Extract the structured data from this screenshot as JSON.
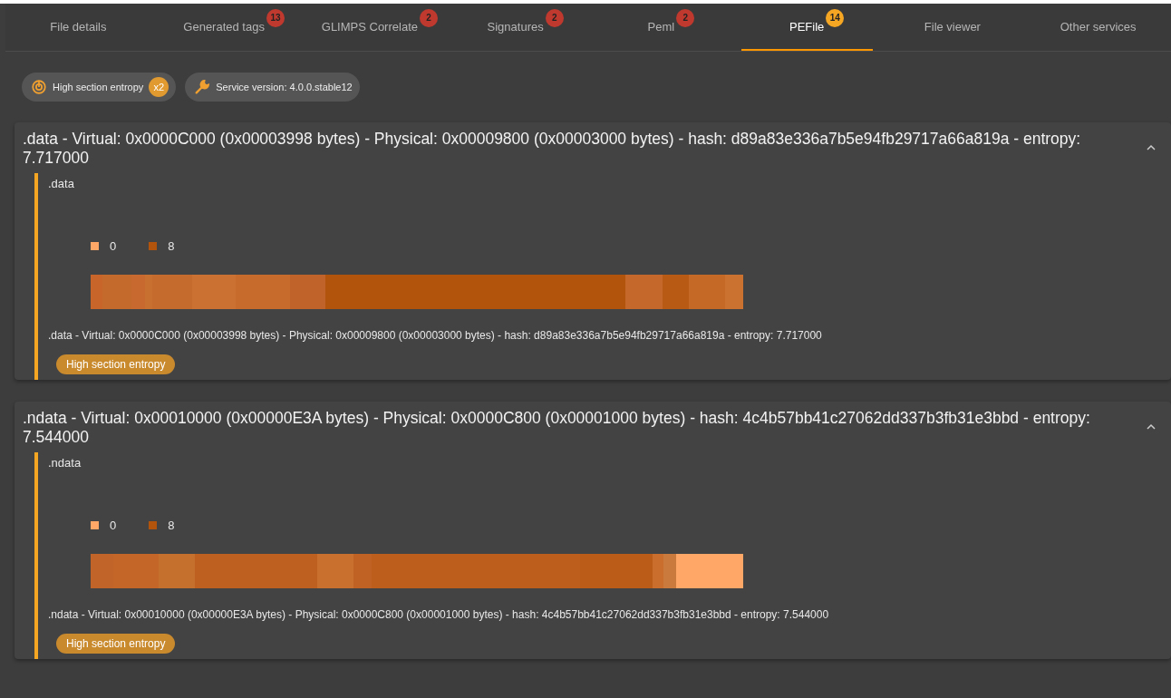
{
  "tabs": [
    {
      "label": "File details",
      "selected": false
    },
    {
      "label": "Generated tags",
      "selected": false,
      "badge": {
        "text": "13",
        "color": "#c0392f"
      }
    },
    {
      "label": "GLIMPS Correlate",
      "selected": false,
      "badge": {
        "text": "2",
        "color": "#c0392f"
      }
    },
    {
      "label": "Signatures",
      "selected": false,
      "badge": {
        "text": "2",
        "color": "#c0392f"
      }
    },
    {
      "label": "Peml",
      "selected": false,
      "badge": {
        "text": "2",
        "color": "#c0392f"
      }
    },
    {
      "label": "PEFile",
      "selected": true,
      "badge": {
        "text": "14",
        "color": "#f5a623"
      }
    },
    {
      "label": "File viewer",
      "selected": false
    },
    {
      "label": "Other services",
      "selected": false
    }
  ],
  "chips": [
    {
      "kind": "heuristic",
      "label": "High section entropy",
      "count": "x2"
    },
    {
      "kind": "service",
      "label": "Service version: 4.0.0.stable12"
    }
  ],
  "sections": [
    {
      "title": ".data - Virtual: 0x0000C000 (0x00003998 bytes) - Physical: 0x00009800 (0x00003000 bytes) - hash: d89a83e336a7b5e94fb29717a66a819a - entropy: 7.717000",
      "expanded": true,
      "name": ".data",
      "legend": [
        "0",
        "8"
      ],
      "description": ".data - Virtual: 0x0000C000 (0x00003998 bytes) - Physical: 0x00009800 (0x00003000 bytes) - hash: d89a83e336a7b5e94fb29717a66a819a - entropy: 7.717000",
      "tags": [
        "High section entropy"
      ]
    },
    {
      "title": ".ndata - Virtual: 0x00010000 (0x00000E3A bytes) - Physical: 0x0000C800 (0x00001000 bytes) - hash: 4c4b57bb41c27062dd337b3fb31e3bbd - entropy: 7.544000",
      "expanded": true,
      "name": ".ndata",
      "legend": [
        "0",
        "8"
      ],
      "description": ".ndata - Virtual: 0x00010000 (0x00000E3A bytes) - Physical: 0x0000C800 (0x00001000 bytes) - hash: 4c4b57bb41c27062dd337b3fb31e3bbd - entropy: 7.544000",
      "tags": [
        "High section entropy"
      ]
    }
  ]
}
